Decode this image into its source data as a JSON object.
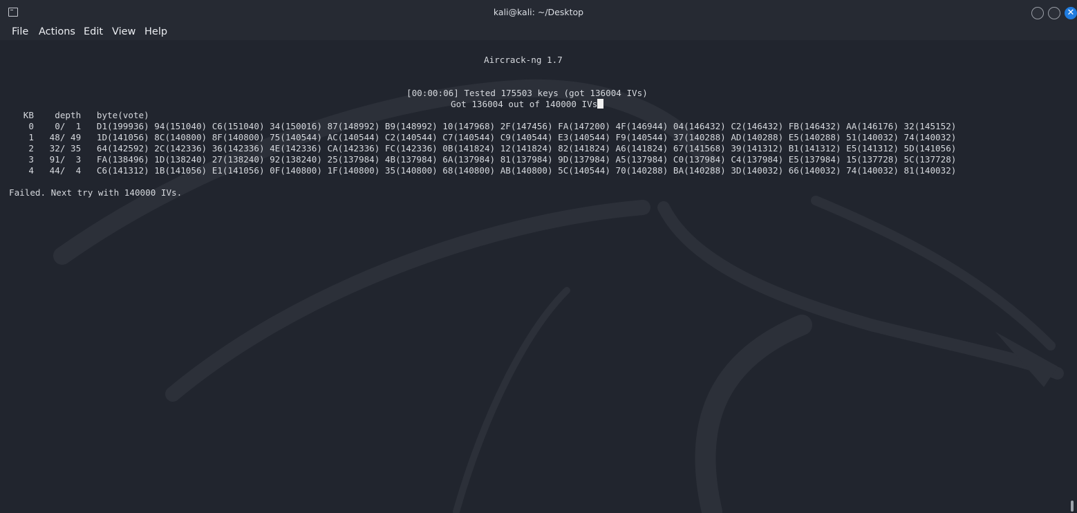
{
  "window": {
    "title": "kali@kali: ~/Desktop",
    "icon": "terminal-icon",
    "close_glyph": "✕"
  },
  "menu": {
    "items": [
      "File",
      "Actions",
      "Edit",
      "View",
      "Help"
    ]
  },
  "terminal": {
    "banner": "Aircrack-ng 1.7",
    "status_line": "[00:00:06] Tested 175503 keys (got 136004 IVs)",
    "got_line": "Got 136004 out of 140000 IVs",
    "table_header": "   KB    depth   byte(vote)",
    "rows": [
      "    0    0/  1   D1(199936) 94(151040) C6(151040) 34(150016) 87(148992) B9(148992) 10(147968) 2F(147456) FA(147200) 4F(146944) 04(146432) C2(146432) FB(146432) AA(146176) 32(145152)",
      "    1   48/ 49   1D(141056) 8C(140800) 8F(140800) 75(140544) AC(140544) C2(140544) C7(140544) C9(140544) E3(140544) F9(140544) 37(140288) AD(140288) E5(140288) 51(140032) 74(140032)",
      "    2   32/ 35   64(142592) 2C(142336) 36(142336) 4E(142336) CA(142336) FC(142336) 0B(141824) 12(141824) 82(141824) A6(141824) 67(141568) 39(141312) B1(141312) E5(141312) 5D(141056)",
      "    3   91/  3   FA(138496) 1D(138240) 27(138240) 92(138240) 25(137984) 4B(137984) 6A(137984) 81(137984) 9D(137984) A5(137984) C0(137984) C4(137984) E5(137984) 15(137728) 5C(137728)",
      "    4   44/  4   C6(141312) 1B(141056) E1(141056) 0F(140800) 1F(140800) 35(140800) 68(140800) AB(140800) 5C(140544) 70(140288) BA(140288) 3D(140032) 66(140032) 74(140032) 81(140032)"
    ],
    "result_line": "Failed. Next try with 140000 IVs."
  },
  "colors": {
    "background": "#1f232b",
    "text": "#d6d9de",
    "accent_close": "#1f7ce0"
  }
}
